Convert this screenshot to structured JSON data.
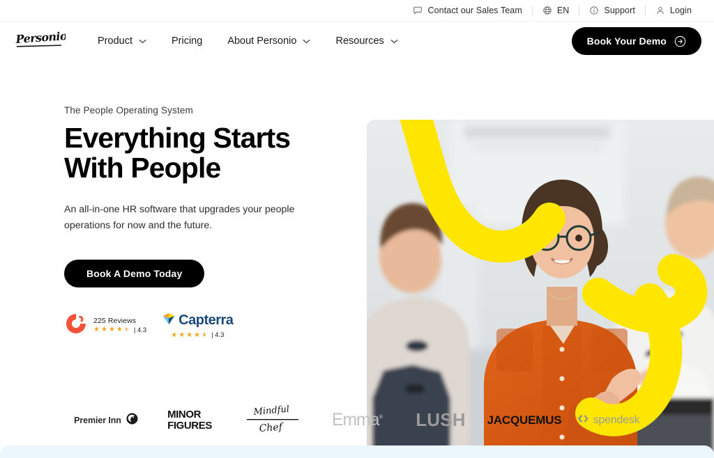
{
  "utility_bar": {
    "items": [
      {
        "label": "Contact our Sales Team",
        "icon": "chat-bubble-icon"
      },
      {
        "label": "EN",
        "icon": "globe-icon"
      },
      {
        "label": "Support",
        "icon": "info-circle-icon"
      },
      {
        "label": "Login",
        "icon": "user-icon"
      }
    ]
  },
  "nav": {
    "logo_text": "Personio",
    "links": [
      {
        "label": "Product",
        "has_dropdown": true
      },
      {
        "label": "Pricing",
        "has_dropdown": false
      },
      {
        "label": "About Personio",
        "has_dropdown": true
      },
      {
        "label": "Resources",
        "has_dropdown": true
      }
    ],
    "cta_label": "Book Your Demo"
  },
  "hero": {
    "eyebrow": "The People Operating System",
    "title": "Everything Starts With People",
    "subtitle": "An all-in-one HR software that upgrades your people operations for now and the future.",
    "cta_label": "Book A Demo Today",
    "badges": [
      {
        "name": "g2",
        "logo_text": "G2",
        "label": "225 Reviews",
        "score": "| 4.3",
        "stars": 4.5,
        "color": "#f2513a"
      },
      {
        "name": "capterra",
        "logo_text": "Capterra",
        "label": "",
        "score": "| 4.3",
        "stars": 4.5,
        "color": "#1b4a7a"
      }
    ]
  },
  "logo_strip": {
    "brands": [
      {
        "name": "premier-inn",
        "label": "Premier Inn"
      },
      {
        "name": "minor-figures",
        "label_line1": "MINOR",
        "label_line2": "FIGURES"
      },
      {
        "name": "mindful-chef",
        "label_line1": "Mindful",
        "label_line2": "Chef"
      },
      {
        "name": "emma",
        "label": "Emma"
      },
      {
        "name": "lush",
        "label": "LUSH"
      },
      {
        "name": "jacquemus",
        "label": "JACQUEMUS"
      },
      {
        "name": "spendesk",
        "label": "spendesk"
      }
    ]
  },
  "colors": {
    "accent_yellow": "#ffe600",
    "cta_black": "#000000",
    "next_section_bg": "#ebf7fc"
  }
}
